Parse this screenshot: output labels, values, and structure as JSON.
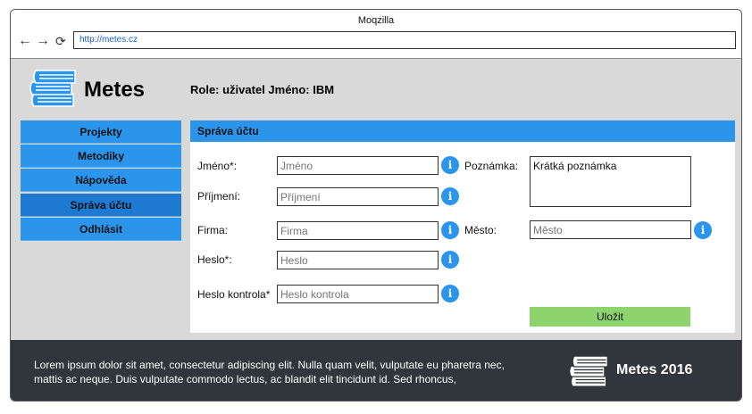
{
  "browser": {
    "title": "Moqzilla",
    "url": "http://metes.cz",
    "back_icon": "←",
    "forward_icon": "→",
    "reload_icon": "⟳"
  },
  "header": {
    "brand": "Metes",
    "role_text": "Role: uživatel Jméno: IBM"
  },
  "sidebar": {
    "items": [
      {
        "label": "Projekty"
      },
      {
        "label": "Metodiky"
      },
      {
        "label": "Nápověda"
      },
      {
        "label": "Správa účtu"
      },
      {
        "label": "Odhlásit"
      }
    ],
    "active_index": 3
  },
  "panel": {
    "title": "Správa účtu",
    "fields": {
      "jmeno": {
        "label": "Jméno*:",
        "placeholder": "Jméno",
        "value": ""
      },
      "prijmeni": {
        "label": "Příjmení:",
        "placeholder": "Příjmení",
        "value": ""
      },
      "firma": {
        "label": "Firma:",
        "placeholder": "Firma",
        "value": ""
      },
      "heslo": {
        "label": "Heslo*:",
        "placeholder": "Heslo",
        "value": ""
      },
      "heslo_kontrola": {
        "label": "Heslo kontrola*",
        "placeholder": "Heslo kontrola",
        "value": ""
      },
      "poznamka": {
        "label": "Poznámka:",
        "value": "Krátká poznámka"
      },
      "mesto": {
        "label": "Město:",
        "placeholder": "Město",
        "value": ""
      }
    },
    "info_glyph": "i",
    "save_label": "Uložit"
  },
  "footer": {
    "text": "Lorem ipsum dolor sit amet, consectetur adipiscing elit. Nulla quam velit, vulputate eu pharetra nec, mattis ac neque. Duis vulputate commodo lectus, ac blandit elit tincidunt id. Sed rhoncus,",
    "brand": "Metes 2016"
  },
  "colors": {
    "accent": "#2b95ec",
    "active_nav": "#1e79d0",
    "save": "#8ed46d",
    "footer_bg": "#30363c"
  }
}
